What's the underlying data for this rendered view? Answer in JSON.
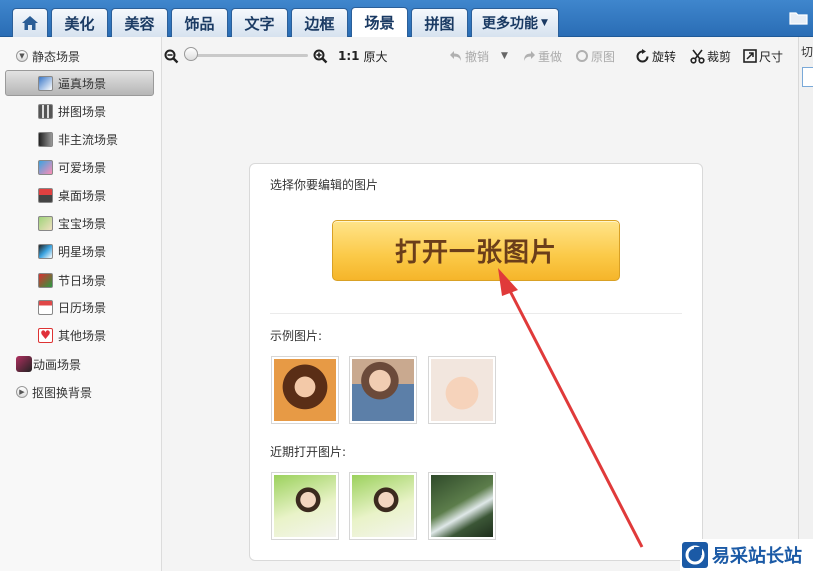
{
  "tabs": [
    {
      "label": "",
      "icon": "home-icon"
    },
    {
      "label": "美化"
    },
    {
      "label": "美容"
    },
    {
      "label": "饰品"
    },
    {
      "label": "文字"
    },
    {
      "label": "边框"
    },
    {
      "label": "场景",
      "active": true
    },
    {
      "label": "拼图"
    },
    {
      "label": "更多功能"
    }
  ],
  "sidebar": {
    "group_static": "静态场景",
    "items": [
      {
        "label": "逼真场景",
        "selected": true
      },
      {
        "label": "拼图场景"
      },
      {
        "label": "非主流场景"
      },
      {
        "label": "可爱场景"
      },
      {
        "label": "桌面场景"
      },
      {
        "label": "宝宝场景"
      },
      {
        "label": "明星场景"
      },
      {
        "label": "节日场景"
      },
      {
        "label": "日历场景"
      },
      {
        "label": "其他场景"
      }
    ],
    "group_animated": "动画场景",
    "group_cutout": "抠图换背景"
  },
  "toolbar": {
    "ratio": "1:1",
    "original_size": "原大",
    "undo": "撤销",
    "redo": "重做",
    "original": "原图",
    "rotate": "旋转",
    "crop": "裁剪",
    "size": "尺寸"
  },
  "right_strip": {
    "label": "切"
  },
  "panel": {
    "title": "选择你要编辑的图片",
    "open_button": "打开一张图片",
    "examples_label": "示例图片:",
    "recent_label": "近期打开图片:"
  },
  "watermark": {
    "text": "易采站长站"
  },
  "colors": {
    "accent": "#2a6db5",
    "button": "#fbc947",
    "arrow": "#e03a3a"
  }
}
